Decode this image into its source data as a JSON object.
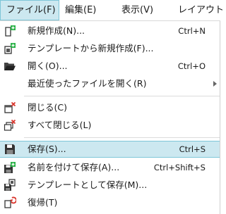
{
  "menubar": {
    "file": "ファイル(F)",
    "edit": "編集(E)",
    "view": "表示(V)",
    "layout": "レイアウト"
  },
  "file_menu": {
    "new": {
      "label": "新規作成(N)...",
      "shortcut": "Ctrl+N",
      "icon": "new-document-icon"
    },
    "new_from_template": {
      "label": "テンプレートから新規作成(F)...",
      "icon": "new-from-template-icon"
    },
    "open": {
      "label": "開く(O)...",
      "shortcut": "Ctrl+O",
      "icon": "folder-open-icon"
    },
    "open_recent": {
      "label": "最近使ったファイルを開く(R)",
      "icon": "submenu-arrow-icon"
    },
    "close": {
      "label": "閉じる(C)",
      "icon": "close-document-icon"
    },
    "close_all": {
      "label": "すべて閉じる(L)",
      "icon": "close-all-icon"
    },
    "save": {
      "label": "保存(S)...",
      "shortcut": "Ctrl+S",
      "icon": "save-icon"
    },
    "save_as": {
      "label": "名前を付けて保存(A)...",
      "shortcut": "Ctrl+Shift+S",
      "icon": "save-as-icon"
    },
    "save_as_template": {
      "label": "テンプレートとして保存(M)...",
      "icon": "save-as-template-icon"
    },
    "revert": {
      "label": "復帰(T)",
      "icon": "revert-icon"
    }
  },
  "colors": {
    "highlight": "#cce8f0",
    "highlight_border": "#7ec6d8",
    "icon_green": "#2db34a",
    "icon_red": "#d9342b"
  }
}
